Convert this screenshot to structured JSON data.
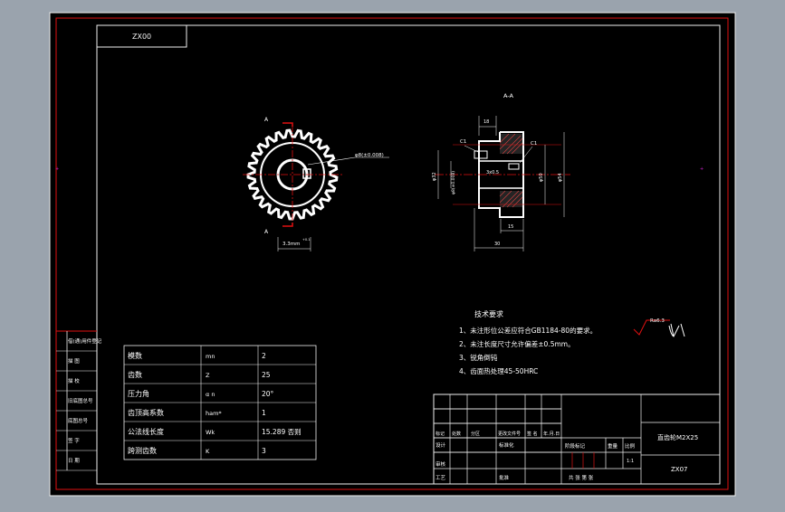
{
  "drawing": {
    "code_box": "ZX00",
    "section_label": "A-A",
    "section_mark_top": "A",
    "section_mark_bottom": "A",
    "tech": {
      "title": "技术要求",
      "items": [
        "1、未注形位公差应符合GB1184-80的要求。",
        "2、未注长度尺寸允许偏差±0.5mm。",
        "3、锐角倒钝",
        "4、齿面热处理45-50HRC"
      ]
    },
    "roughness": "Ra6.3",
    "dimensions": {
      "bore_tol": "φ8(±0.008)",
      "keyway": "3.3mm",
      "keyway_sup": "+0.1",
      "width_top": "18",
      "hub_d": "φ32",
      "bore_d": "φ8(±0.008)",
      "chamfer_left": "C1",
      "chamfer_right": "C1",
      "chamfer_mid": "3x0.5",
      "root_d": "φ50",
      "outer_d": "φ54",
      "hub_len": "15",
      "total_len": "30"
    },
    "params": [
      {
        "name": "模数",
        "sym": "mn",
        "val": "2"
      },
      {
        "name": "齿数",
        "sym": "Z",
        "val": "25"
      },
      {
        "name": "压力角",
        "sym": "α n",
        "val": "20°"
      },
      {
        "name": "齿顶高系数",
        "sym": "ham*",
        "val": "1"
      },
      {
        "name": "公法线长度",
        "sym": "Wk",
        "val": "15.289 否则"
      },
      {
        "name": "跨测齿数",
        "sym": "K",
        "val": "3"
      }
    ],
    "side_labels": [
      "借(通)用件登记",
      "描  图",
      "描  校",
      "旧底图总号",
      "底图总号",
      "签  字",
      "日  期"
    ],
    "title_block": {
      "r1": [
        "标记",
        "处数",
        "分区",
        "更改文件号",
        "签 名",
        "年.月.日"
      ],
      "design": "设计",
      "std": "标准化",
      "check": "审核",
      "process": "工艺",
      "approve": "批准",
      "stage_mark": "阶段标记",
      "weight": "重量",
      "scale": "比例",
      "scale_val": "1:1",
      "sheets": "共  张  第  张",
      "name": "直齿轮M2X25",
      "code": "ZX07"
    }
  }
}
